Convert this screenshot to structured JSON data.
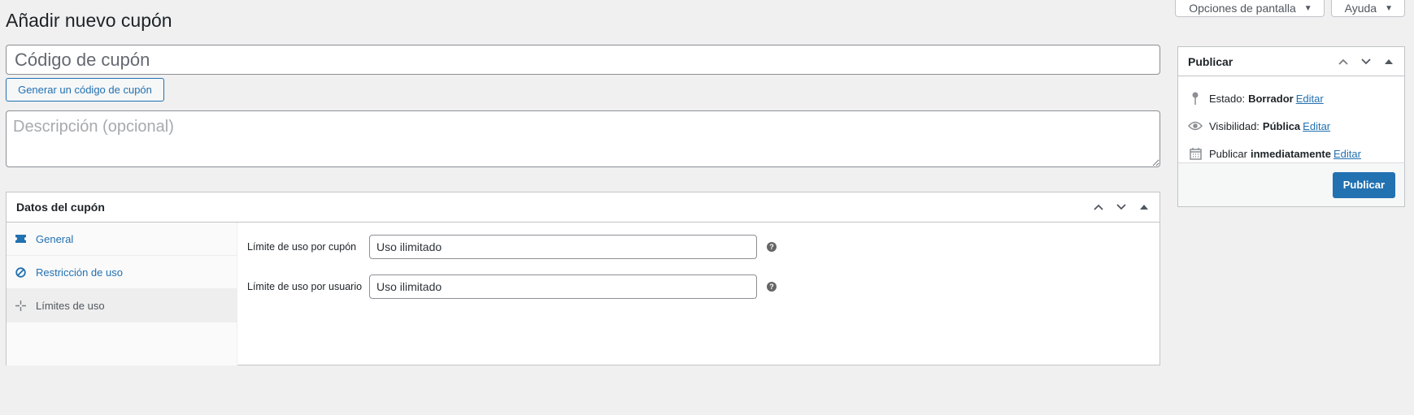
{
  "screen_meta": {
    "screen_options_label": "Opciones de pantalla",
    "help_label": "Ayuda"
  },
  "page": {
    "title": "Añadir nuevo cupón"
  },
  "coupon": {
    "code_placeholder": "Código de cupón",
    "generate_button": "Generar un código de cupón",
    "description_placeholder": "Descripción (opcional)"
  },
  "coupon_data": {
    "title": "Datos del cupón",
    "tabs": [
      {
        "label": "General",
        "icon": "ticket-icon",
        "active": false
      },
      {
        "label": "Restricción de uso",
        "icon": "ban-icon",
        "active": false
      },
      {
        "label": "Límites de uso",
        "icon": "crosshair-icon",
        "active": true
      }
    ],
    "fields": [
      {
        "label": "Límite de uso por cupón",
        "value": "Uso ilimitado"
      },
      {
        "label": "Límite de uso por usuario",
        "value": "Uso ilimitado"
      }
    ],
    "help_glyph": "?"
  },
  "publish": {
    "title": "Publicar",
    "status_label": "Estado:",
    "status_value": "Borrador",
    "visibility_label": "Visibilidad:",
    "visibility_value": "Pública",
    "schedule_label": "Publicar",
    "schedule_value": "inmediatamente",
    "edit_label": "Editar",
    "button": "Publicar"
  },
  "colors": {
    "accent": "#2271b1",
    "background": "#f0f0f1",
    "border": "#c3c4c7"
  }
}
